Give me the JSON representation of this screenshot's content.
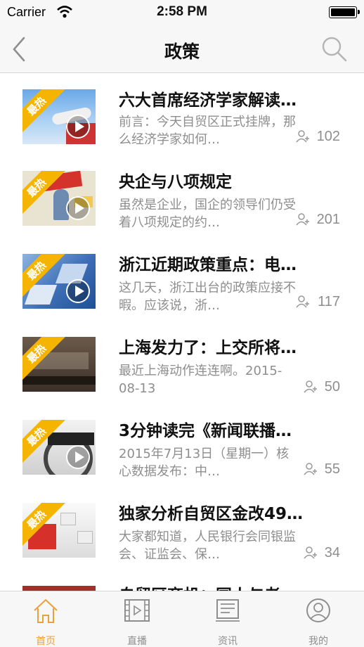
{
  "status_bar": {
    "carrier": "Carrier",
    "time": "2:58 PM"
  },
  "nav": {
    "title": "政策",
    "back_icon": "chevron-left-icon",
    "search_icon": "search-icon"
  },
  "badge_label": "最热",
  "items": [
    {
      "title": "六大首席经济学家解读…",
      "desc": "前言：今天自贸区正式挂牌，那么经济学家如何…",
      "count": "102"
    },
    {
      "title": "央企与八项规定",
      "desc": "虽然是企业，国企的领导们仍受着八项规定的约…",
      "count": "201"
    },
    {
      "title": "浙江近期政策重点：电…",
      "desc": "这几天，浙江出台的政策应接不暇。应该说，浙…",
      "count": "117"
    },
    {
      "title": "上海发力了：上交所将…",
      "desc": "最近上海动作连连啊。2015-08-13",
      "count": "50"
    },
    {
      "title": "3分钟读完《新闻联播…",
      "desc": "2015年7月13日（星期一）核心数据发布：中…",
      "count": "55"
    },
    {
      "title": "独家分析自贸区金改49…",
      "desc": "大家都知道，人民银行会同银监会、证监会、保…",
      "count": "34"
    },
    {
      "title": "自贸区商机：国人与老…",
      "desc": "",
      "count": ""
    }
  ],
  "tabs": [
    {
      "label": "首页",
      "icon": "home-icon",
      "active": true
    },
    {
      "label": "直播",
      "icon": "film-icon",
      "active": false
    },
    {
      "label": "资讯",
      "icon": "news-icon",
      "active": false
    },
    {
      "label": "我的",
      "icon": "profile-icon",
      "active": false
    }
  ],
  "colors": {
    "accent": "#e8a23b",
    "badge": "#f4b400",
    "muted": "#8e8e8e"
  }
}
